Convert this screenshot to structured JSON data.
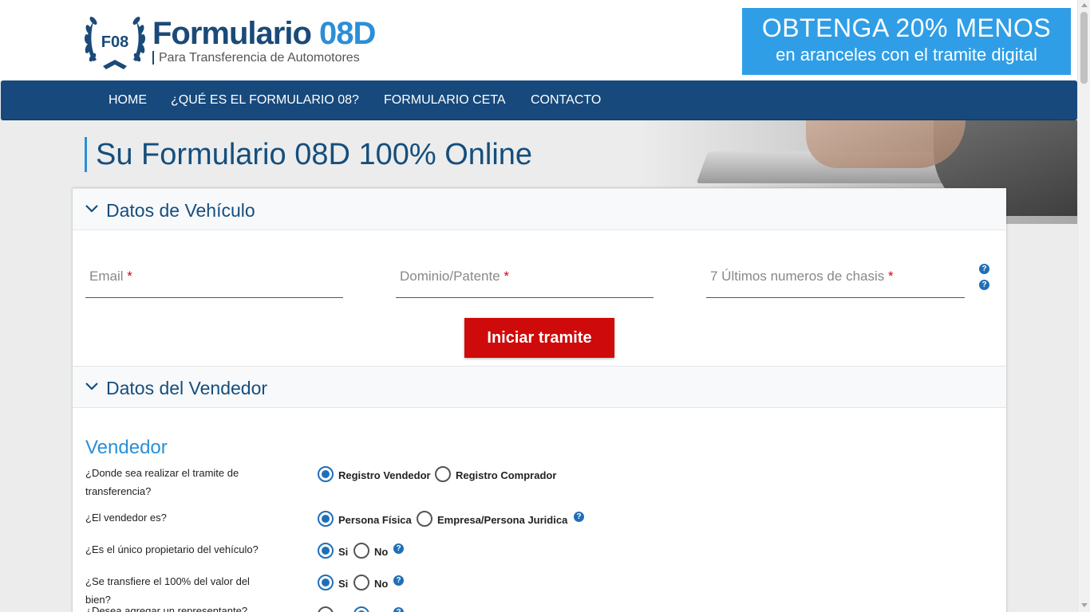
{
  "header": {
    "logo_emblem_text": "F08",
    "title_main": "Formulario",
    "title_accent": "08D",
    "subtitle": "Para Transferencia de Automotores"
  },
  "promo": {
    "line1": "OBTENGA 20% MENOS",
    "line2": "en aranceles con el tramite digital"
  },
  "nav": {
    "items": [
      {
        "label": "HOME"
      },
      {
        "label": "¿QUÉ ES EL FORMULARIO 08?"
      },
      {
        "label": "FORMULARIO CETA"
      },
      {
        "label": "CONTACTO"
      }
    ]
  },
  "hero": {
    "title": "Su Formulario 08D 100% Online"
  },
  "vehicle_section": {
    "title": "Datos de Vehículo",
    "fields": [
      {
        "label": "Email",
        "required_mark": "*",
        "value": ""
      },
      {
        "label": "Dominio/Patente",
        "required_mark": "*",
        "value": ""
      },
      {
        "label": "7 Últimos numeros de chasis",
        "required_mark": "*",
        "value": ""
      }
    ],
    "help_glyph": "?",
    "start_button": "Iniciar tramite"
  },
  "seller_section": {
    "title": "Datos del Vendedor",
    "subtitle": "Vendedor",
    "questions": [
      {
        "question": "¿Donde sea realizar el tramite de transferencia?",
        "options": [
          "Registro Vendedor",
          "Registro Comprador"
        ],
        "selected": 0
      },
      {
        "question": "¿El vendedor es?",
        "options": [
          "Persona Física",
          "Empresa/Persona Juridica"
        ],
        "selected": 0
      },
      {
        "question": "¿Es el único propietario del vehículo?",
        "options": [
          "Si",
          "No"
        ],
        "selected": 0
      },
      {
        "question": "¿Se transfiere el 100% del valor del bien?",
        "options": [
          "Si",
          "No"
        ],
        "selected": 0
      },
      {
        "question": "¿Desea agregar un representante?",
        "options": [
          "Si",
          "No"
        ],
        "selected": 1
      }
    ]
  },
  "colors": {
    "nav_bg": "#17497c",
    "promo_bg": "#2f9ee6",
    "primary_text": "#154e7d",
    "accent": "#2a8fd8",
    "button_red": "#cf0a0a"
  }
}
